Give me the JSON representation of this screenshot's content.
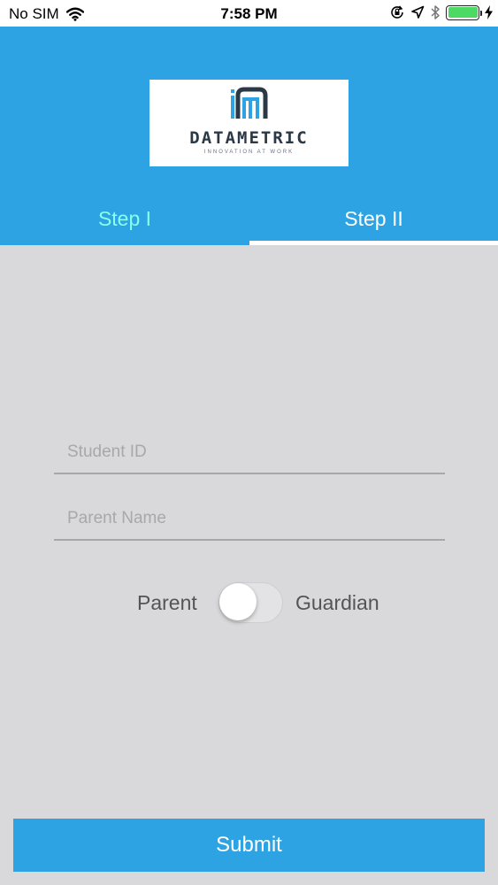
{
  "status_bar": {
    "carrier": "No SIM",
    "time": "7:58 PM",
    "battery_level": 1.0,
    "icons": [
      "wifi-icon",
      "rotation-lock-icon",
      "location-arrow-icon",
      "bluetooth-icon",
      "battery-icon",
      "charging-bolt-icon"
    ]
  },
  "logo": {
    "brand": "DATAMETRIC",
    "tagline": "INNOVATION AT WORK",
    "colors": {
      "dark": "#2b3947",
      "accent": "#2ea3e3"
    }
  },
  "tabs": [
    {
      "label": "Step I",
      "selected": false
    },
    {
      "label": "Step II",
      "selected": true
    }
  ],
  "form": {
    "student_id": {
      "placeholder": "Student ID",
      "value": ""
    },
    "parent_name": {
      "placeholder": "Parent Name",
      "value": ""
    },
    "toggle": {
      "left_label": "Parent",
      "right_label": "Guardian",
      "on": false
    }
  },
  "submit_label": "Submit",
  "colors": {
    "header": "#2ea3e3",
    "background": "#d9d9db",
    "inactive_tab_text": "#88ffe8",
    "active_tab_text": "#ffffff"
  }
}
